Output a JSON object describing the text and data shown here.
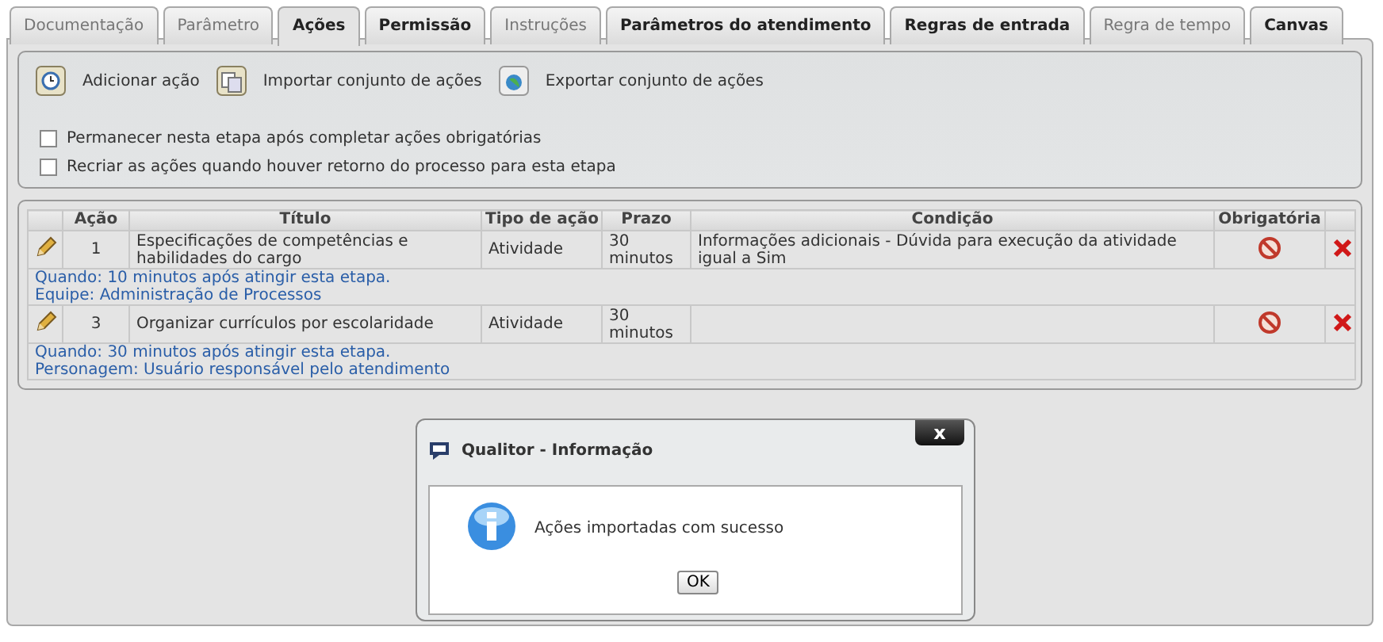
{
  "tabs": [
    {
      "label": "Documentação",
      "selected": false,
      "disabled": true
    },
    {
      "label": "Parâmetro",
      "selected": false,
      "disabled": true
    },
    {
      "label": "Ações",
      "selected": true,
      "disabled": false
    },
    {
      "label": "Permissão",
      "selected": false,
      "disabled": false
    },
    {
      "label": "Instruções",
      "selected": false,
      "disabled": true
    },
    {
      "label": "Parâmetros do atendimento",
      "selected": false,
      "disabled": false
    },
    {
      "label": "Regras de entrada",
      "selected": false,
      "disabled": false
    },
    {
      "label": "Regra de tempo",
      "selected": false,
      "disabled": true
    },
    {
      "label": "Canvas",
      "selected": false,
      "disabled": false
    }
  ],
  "toolbar": [
    {
      "kind": "add",
      "label": "Adicionar ação"
    },
    {
      "kind": "import",
      "label": "Importar conjunto de ações"
    },
    {
      "kind": "export",
      "label": "Exportar conjunto de ações"
    }
  ],
  "options": [
    {
      "label": "Permanecer nesta etapa após completar ações obrigatórias",
      "checked": false
    },
    {
      "label": "Recriar as ações quando houver retorno do processo para esta etapa",
      "checked": false
    }
  ],
  "table": {
    "columns": [
      "Ação",
      "Título",
      "Tipo de ação",
      "Prazo",
      "Condição",
      "Obrigatória"
    ],
    "rows": [
      {
        "action": "1",
        "title": "Especificações de competências e habilidades do cargo",
        "type": "Atividade",
        "deadline": "30 minutos",
        "condition": "Informações adicionais - Dúvida para execução da atividade igual a Sim",
        "details": [
          "Quando: 10 minutos após atingir esta etapa.",
          "Equipe: Administração de Processos"
        ]
      },
      {
        "action": "3",
        "title": "Organizar currículos por escolaridade",
        "type": "Atividade",
        "deadline": "30 minutos",
        "details": [
          "Quando: 30 minutos após atingir esta etapa.",
          "Personagem: Usuário responsável pelo atendimento"
        ]
      }
    ]
  },
  "dialog": {
    "title": "Qualitor - Informação",
    "close": "x",
    "message": "Ações importadas com sucesso",
    "button": "OK"
  }
}
